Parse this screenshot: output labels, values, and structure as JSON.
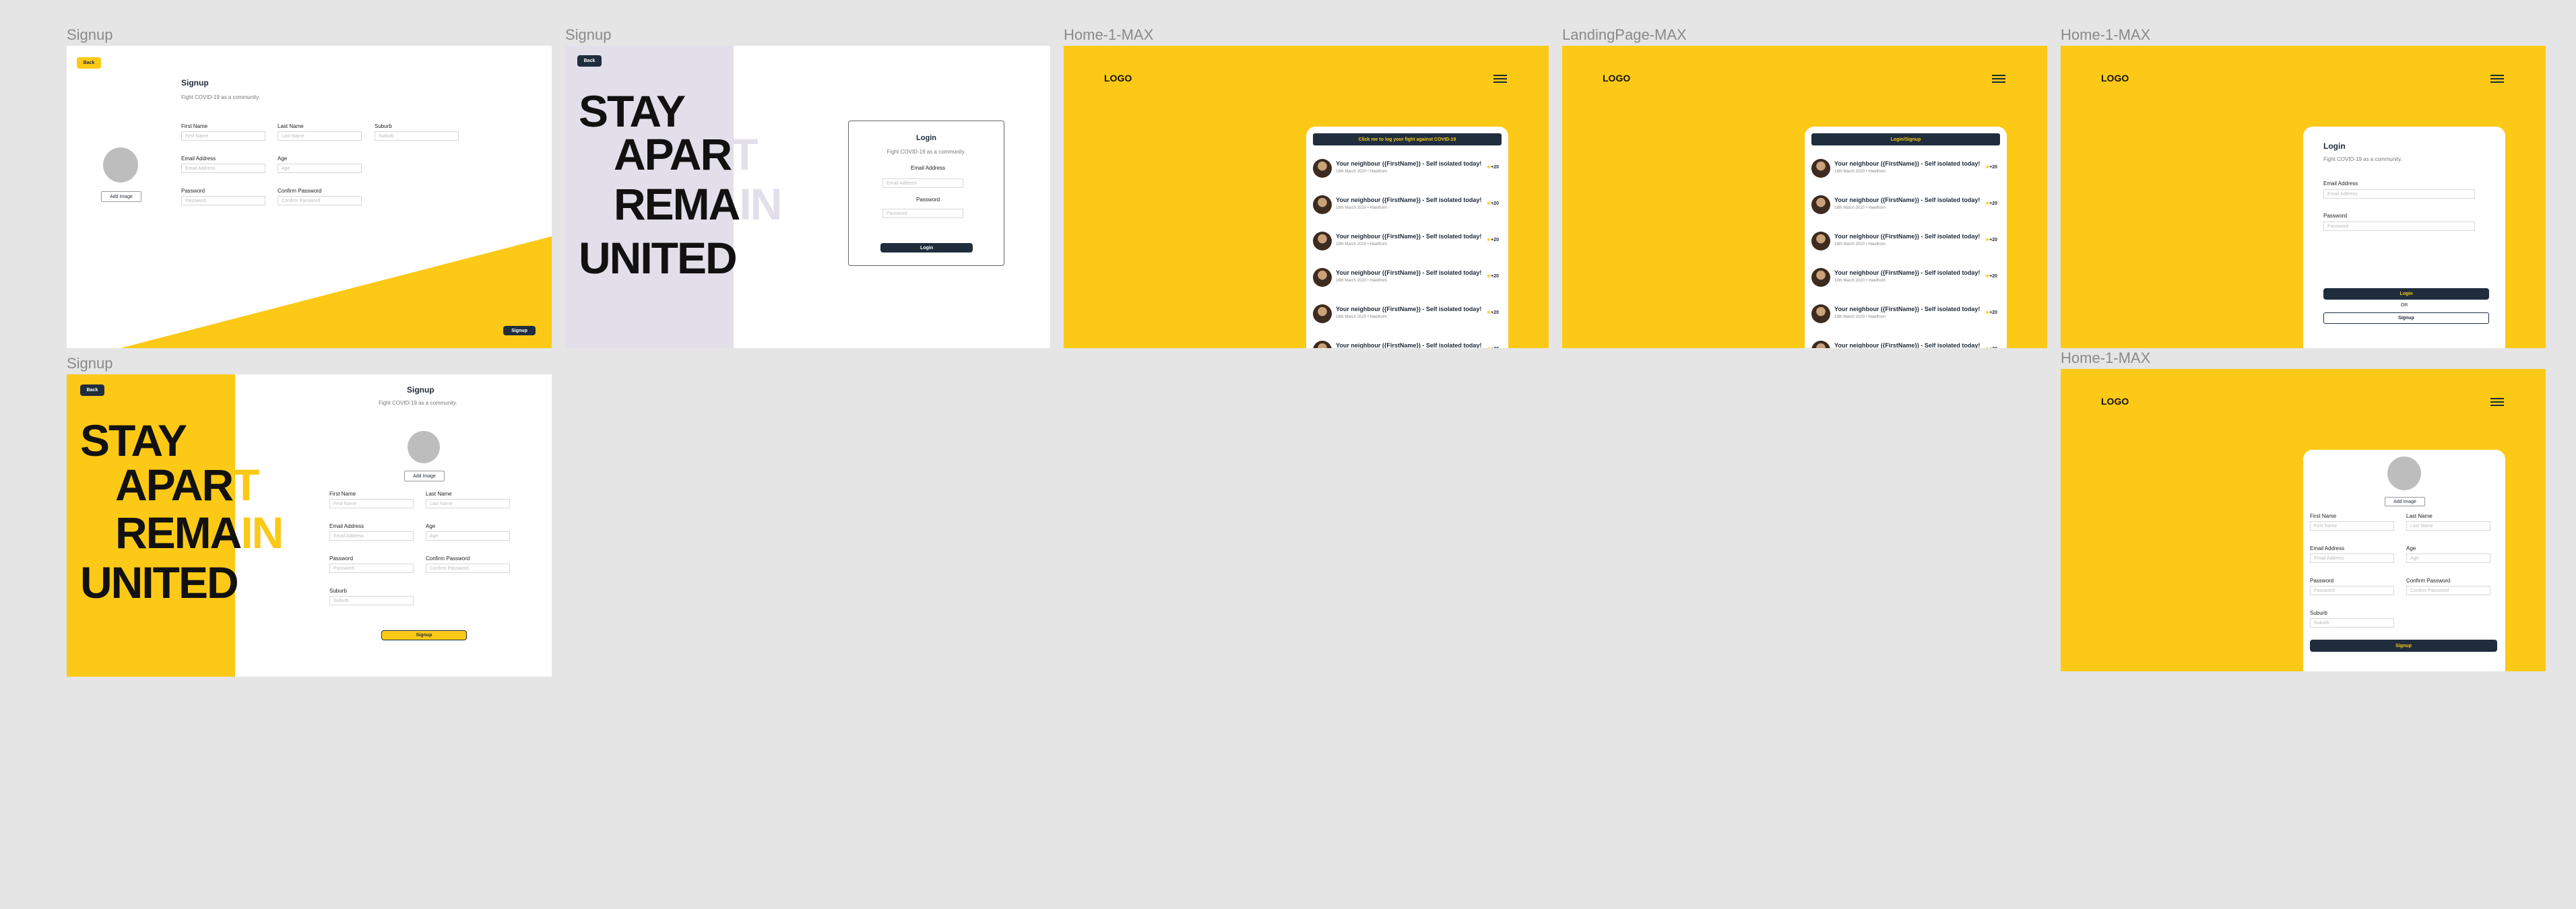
{
  "frames": [
    {
      "label": "Signup"
    },
    {
      "label": "Signup"
    },
    {
      "label": "Home-1-MAX"
    },
    {
      "label": "LandingPage-MAX"
    },
    {
      "label": "Home-1-MAX"
    },
    {
      "label": "Signup"
    },
    {
      "label": "Home-1-MAX"
    }
  ],
  "common": {
    "back": "Back",
    "signup_title": "Signup",
    "subtitle": "Fight COVID-19 as a community.",
    "add_image": "Add Image",
    "signup_button": "Signup",
    "logo": "LOGO"
  },
  "fields": {
    "first_name": {
      "label": "First Name",
      "placeholder": "First Name"
    },
    "last_name": {
      "label": "Last Name",
      "placeholder": "Last Name"
    },
    "suburb": {
      "label": "Suburb",
      "placeholder": "Suburb"
    },
    "email": {
      "label": "Email Address",
      "placeholder": "Email Address"
    },
    "age": {
      "label": "Age",
      "placeholder": "Age"
    },
    "password": {
      "label": "Password",
      "placeholder": "Password"
    },
    "confirm_password": {
      "label": "Confirm Password",
      "placeholder": "Confirm Password"
    }
  },
  "hero": {
    "line1": "STAY",
    "line2a": "APAR",
    "line2b": "T",
    "line3a": "REMA",
    "line3b": "IN",
    "line4": "UNITED"
  },
  "login": {
    "title": "Login",
    "subtitle": "Fight COVID-19 as a community.",
    "email_label": "Email Address",
    "email_placeholder": "Email Address",
    "password_label": "Password",
    "password_placeholder": "Password",
    "button": "Login",
    "or": "OR",
    "signup": "Signup"
  },
  "feed": {
    "banner_home": "Click me to log your fight against COVID-19",
    "banner_landing": "Login/Signup",
    "item_title": "Your neighbour ({FirstName}) - Self isolated today!",
    "item_sub": "18th March 2020 • Hawthorn",
    "item_count": "+20"
  },
  "colors": {
    "yellow": "#fcc916",
    "navy": "#1f2d3d",
    "lavender": "#e2dfeb",
    "canvas": "#e5e5e5"
  }
}
